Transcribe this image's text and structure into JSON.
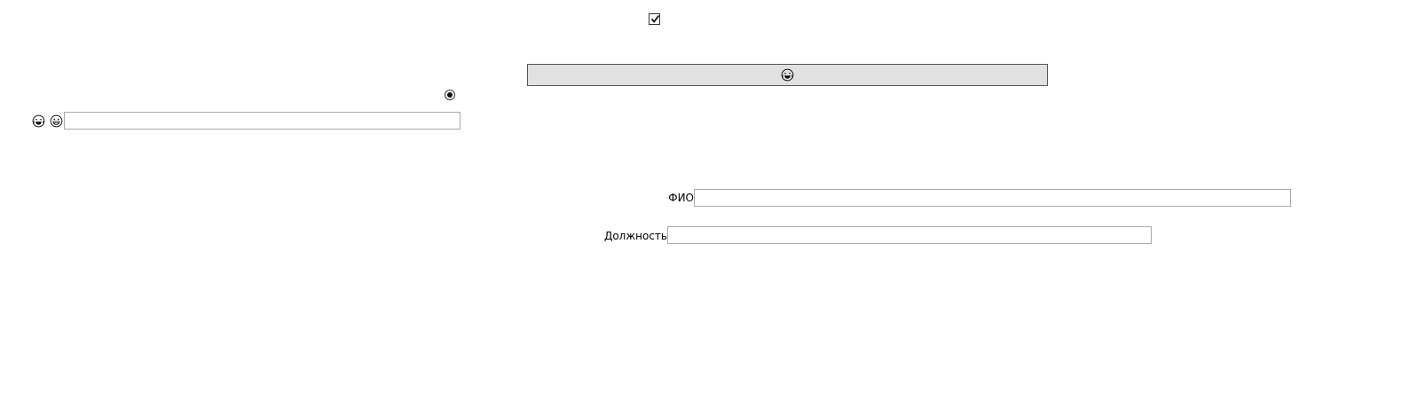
{
  "checkbox": {
    "checked": true,
    "icon": "checkmark-icon"
  },
  "top_button": {
    "icon": "laughing-face-icon"
  },
  "radio": {
    "selected": true
  },
  "left_row": {
    "icons": [
      "laughing-face-icon",
      "grinning-face-icon"
    ],
    "input_value": ""
  },
  "form": {
    "fio_label": "ФИО",
    "fio_value": "",
    "position_label": "Должность",
    "position_value": ""
  }
}
